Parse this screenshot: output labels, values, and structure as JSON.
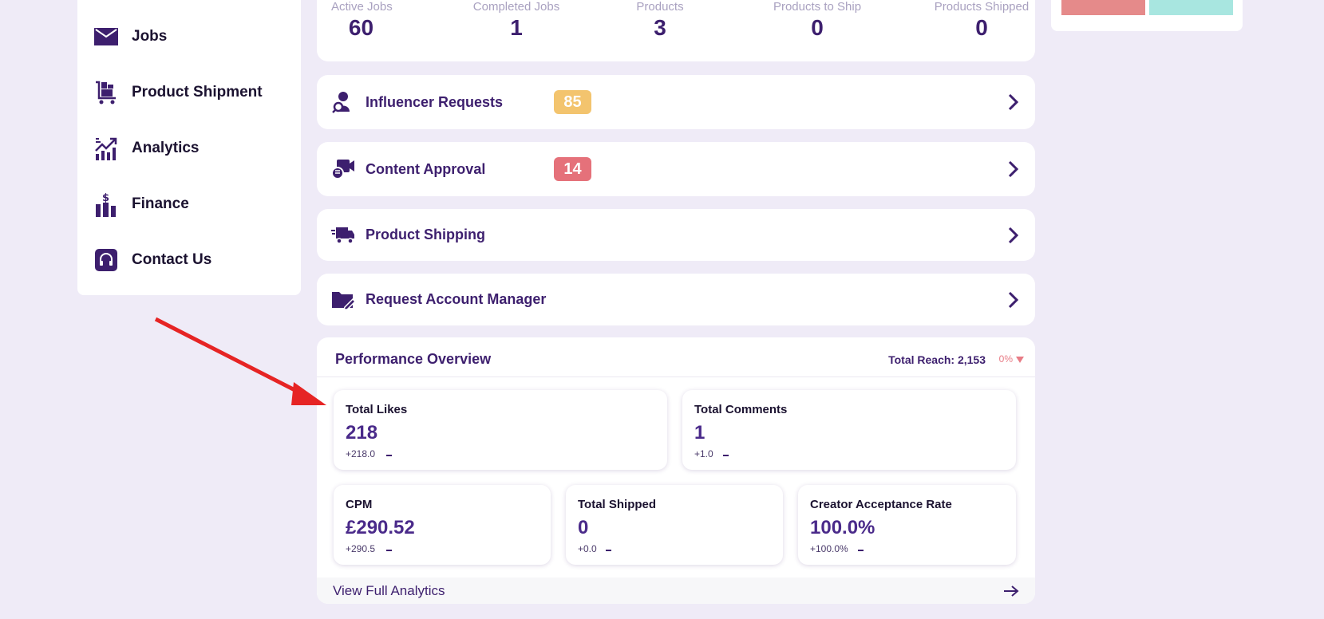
{
  "sidebar": {
    "items": [
      {
        "label": "Jobs",
        "icon": "envelope-icon"
      },
      {
        "label": "Product Shipment",
        "icon": "cart-boxes-icon"
      },
      {
        "label": "Analytics",
        "icon": "growth-chart-icon"
      },
      {
        "label": "Finance",
        "icon": "finance-bars-icon"
      },
      {
        "label": "Contact Us",
        "icon": "headset-icon"
      }
    ]
  },
  "stats": [
    {
      "label": "Active Jobs",
      "value": "60"
    },
    {
      "label": "Completed Jobs",
      "value": "1"
    },
    {
      "label": "Products",
      "value": "3"
    },
    {
      "label": "Products to Ship",
      "value": "0"
    },
    {
      "label": "Products Shipped",
      "value": "0"
    }
  ],
  "rows": [
    {
      "label": "Influencer Requests",
      "badge": "85",
      "badge_color": "#f3c46e"
    },
    {
      "label": "Content Approval",
      "badge": "14",
      "badge_color": "#e5717a"
    },
    {
      "label": "Product Shipping"
    },
    {
      "label": "Request Account Manager"
    }
  ],
  "performance": {
    "title": "Performance Overview",
    "reach": "Total Reach: 2,153",
    "reach_change": "0%",
    "metrics": [
      {
        "label": "Total Likes",
        "value": "218",
        "delta": "+218.0"
      },
      {
        "label": "Total Comments",
        "value": "1",
        "delta": "+1.0"
      },
      {
        "label": "CPM",
        "value": "£290.52",
        "delta": "+290.5"
      },
      {
        "label": "Total Shipped",
        "value": "0",
        "delta": "+0.0"
      },
      {
        "label": "Creator Acceptance Rate",
        "value": "100.0%",
        "delta": "+100.0%"
      }
    ],
    "view_all": "View Full Analytics"
  },
  "colors": {
    "brand": "#3d1f6e",
    "background": "#efebf7",
    "annotation_arrow": "#e62424"
  }
}
